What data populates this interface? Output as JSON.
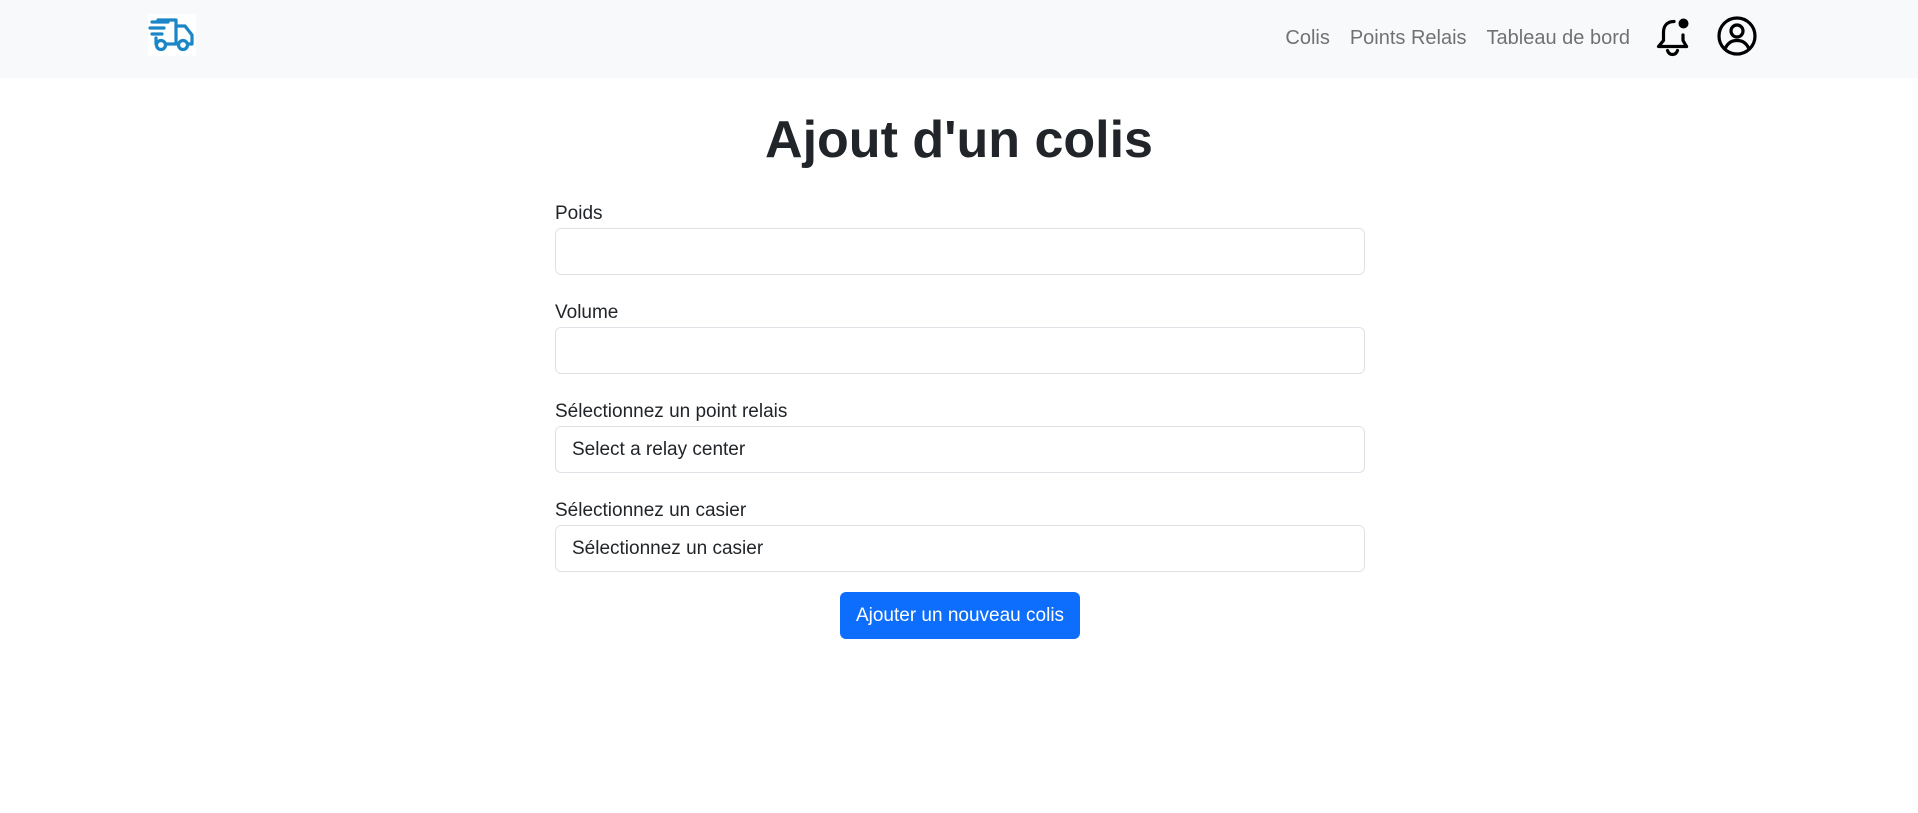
{
  "nav": {
    "logo_icon": "delivery-truck-icon",
    "brand_color": "#1a86c8",
    "links": [
      "Colis",
      "Points Relais",
      "Tableau de bord"
    ],
    "notification_icon": "bell-notification-icon",
    "profile_icon": "user-circle-icon"
  },
  "page": {
    "title": "Ajout d'un colis"
  },
  "form": {
    "weight": {
      "label": "Poids",
      "value": ""
    },
    "volume": {
      "label": "Volume",
      "value": ""
    },
    "relay": {
      "label": "Sélectionnez un point relais",
      "selected": "Select a relay center"
    },
    "locker": {
      "label": "Sélectionnez un casier",
      "selected": "Sélectionnez un casier"
    },
    "submit_label": "Ajouter un nouveau colis",
    "submit_color": "#0d6efd"
  }
}
